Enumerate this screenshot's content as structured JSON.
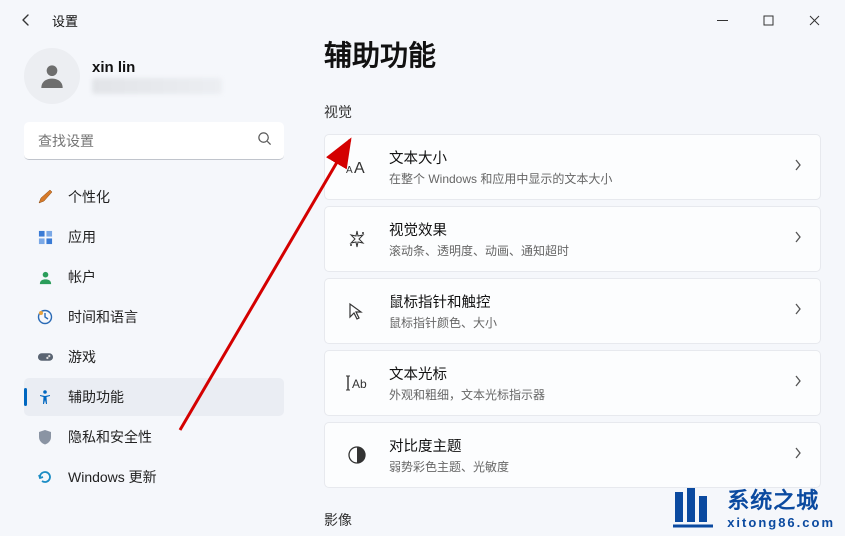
{
  "window": {
    "title": "设置"
  },
  "profile": {
    "name": "xin lin"
  },
  "search": {
    "placeholder": "查找设置"
  },
  "sidebar": {
    "items": [
      {
        "label": "个性化",
        "icon": "brush"
      },
      {
        "label": "应用",
        "icon": "apps"
      },
      {
        "label": "帐户",
        "icon": "person"
      },
      {
        "label": "时间和语言",
        "icon": "time"
      },
      {
        "label": "游戏",
        "icon": "game"
      },
      {
        "label": "辅助功能",
        "icon": "accessibility",
        "active": true
      },
      {
        "label": "隐私和安全性",
        "icon": "shield"
      },
      {
        "label": "Windows 更新",
        "icon": "update"
      }
    ]
  },
  "page": {
    "title": "辅助功能",
    "sections": [
      {
        "label": "视觉",
        "items": [
          {
            "title": "文本大小",
            "sub": "在整个 Windows 和应用中显示的文本大小",
            "icon": "text-size"
          },
          {
            "title": "视觉效果",
            "sub": "滚动条、透明度、动画、通知超时",
            "icon": "visual-effects"
          },
          {
            "title": "鼠标指针和触控",
            "sub": "鼠标指针颜色、大小",
            "icon": "mouse"
          },
          {
            "title": "文本光标",
            "sub": "外观和粗细，文本光标指示器",
            "icon": "text-cursor"
          },
          {
            "title": "对比度主题",
            "sub": "弱势彩色主题、光敏度",
            "icon": "contrast"
          }
        ]
      },
      {
        "label": "影像",
        "items": []
      }
    ]
  },
  "watermark": {
    "cn": "系统之城",
    "en": "xitong86.com"
  }
}
